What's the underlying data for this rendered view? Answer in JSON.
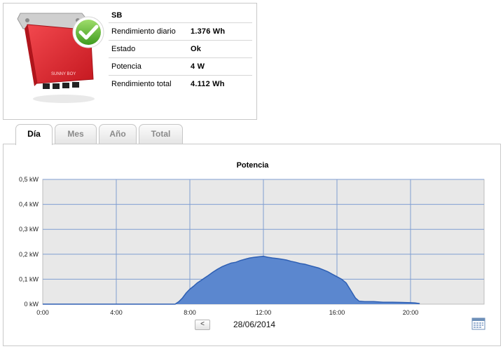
{
  "device": {
    "name": "SB",
    "image_brand": "SUNNY BOY",
    "rows": [
      {
        "label": "Rendimiento diario",
        "value": "1.376  Wh"
      },
      {
        "label": "Estado",
        "value": "Ok"
      },
      {
        "label": "Potencia",
        "value": "4  W"
      },
      {
        "label": "Rendimiento total",
        "value": "4.112  Wh"
      }
    ]
  },
  "tabs": [
    "Día",
    "Mes",
    "Año",
    "Total"
  ],
  "active_tab": "Día",
  "navigation": {
    "prev_symbol": "<",
    "date": "28/06/2014"
  },
  "colors": {
    "fill": "#5b87cf",
    "line": "#2e5fb3",
    "plot_bg": "#e8e8e8",
    "grid": "#7f9ed1"
  },
  "chart_data": {
    "type": "area",
    "title": "Potencia",
    "xlabel": "",
    "ylabel": "",
    "x_ticks": [
      "0:00",
      "4:00",
      "8:00",
      "12:00",
      "16:00",
      "20:00"
    ],
    "y_ticks": [
      "0 kW",
      "0,1 kW",
      "0,2 kW",
      "0,3 kW",
      "0,4 kW",
      "0,5 kW"
    ],
    "xlim": [
      0,
      24
    ],
    "ylim": [
      0,
      0.5
    ],
    "grid": true,
    "series": [
      {
        "x": [
          0,
          7.2,
          7.4,
          7.6,
          7.8,
          8.0,
          8.2,
          8.4,
          8.6,
          8.8,
          9.0,
          9.25,
          9.5,
          9.75,
          10.0,
          10.25,
          10.5,
          10.75,
          11.0,
          11.25,
          11.5,
          11.75,
          12.0,
          12.25,
          12.5,
          12.75,
          13.0,
          13.25,
          13.5,
          13.75,
          14.0,
          14.25,
          14.5,
          14.75,
          15.0,
          15.25,
          15.5,
          15.75,
          16.0,
          16.25,
          16.5,
          16.75,
          17.0,
          17.2,
          17.5,
          18.0,
          18.5,
          19.0,
          19.5,
          20.0,
          20.25,
          20.5
        ],
        "y": [
          0,
          0,
          0.01,
          0.025,
          0.045,
          0.06,
          0.072,
          0.085,
          0.095,
          0.105,
          0.115,
          0.128,
          0.14,
          0.15,
          0.158,
          0.165,
          0.168,
          0.175,
          0.18,
          0.185,
          0.188,
          0.19,
          0.192,
          0.188,
          0.185,
          0.183,
          0.18,
          0.177,
          0.172,
          0.168,
          0.163,
          0.16,
          0.155,
          0.15,
          0.145,
          0.138,
          0.13,
          0.12,
          0.11,
          0.1,
          0.085,
          0.055,
          0.025,
          0.012,
          0.01,
          0.01,
          0.008,
          0.008,
          0.007,
          0.006,
          0.005,
          0.002
        ]
      }
    ]
  }
}
